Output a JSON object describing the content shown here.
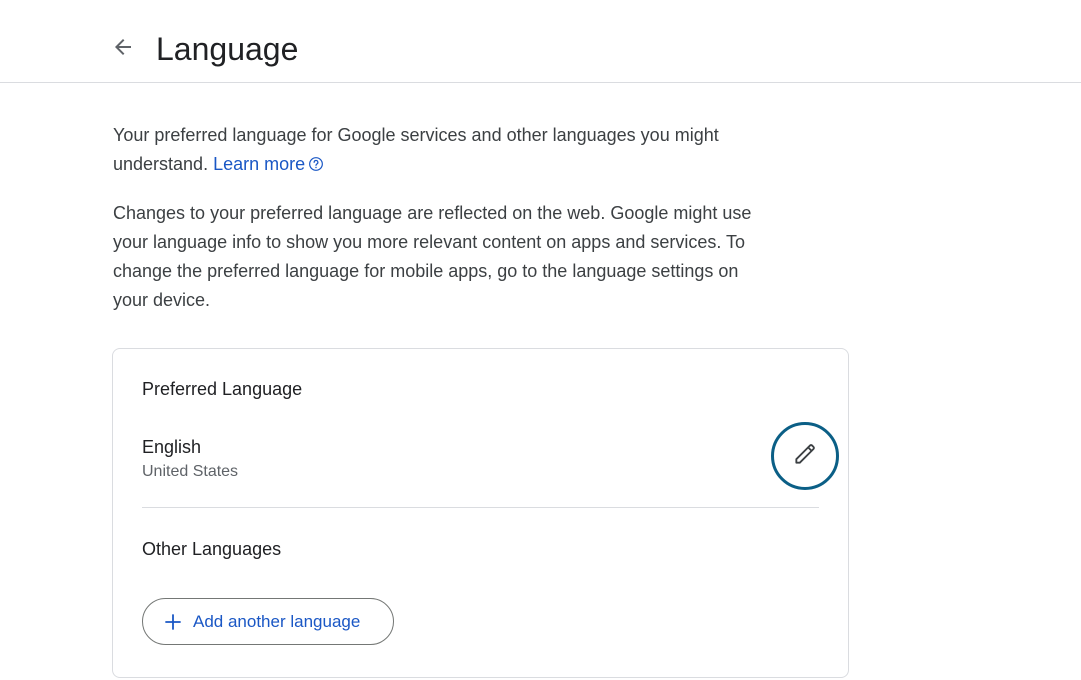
{
  "header": {
    "title": "Language",
    "back_icon": "arrow-back-icon"
  },
  "intro": {
    "paragraph1_text": "Your preferred language for Google services and other languages you might understand. ",
    "learn_more_label": "Learn more",
    "paragraph2_text": "Changes to your preferred language are reflected on the web. Google might use your language info to show you more relevant content on apps and ser­vices. To change the preferred language for mobile apps, go to the lan­guage settings on your device."
  },
  "card": {
    "preferred_title": "Preferred Language",
    "preferred_language": {
      "name": "English",
      "region": "United States"
    },
    "edit_icon": "pencil-icon",
    "other_title": "Other Languages",
    "add_button_label": "Add another language"
  },
  "colors": {
    "accent": "#1a57c5",
    "focus_ring": "#0b5f86",
    "divider": "#dadce0"
  }
}
